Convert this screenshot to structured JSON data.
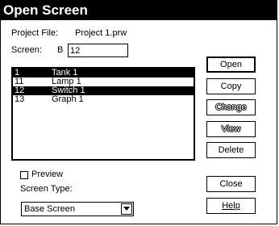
{
  "dialog": {
    "title": "Open Screen",
    "project_file_label": "Project File:",
    "project_file_value": "Project 1.prw",
    "screen_label": "Screen:",
    "screen_type_code": "B",
    "screen_number": "12"
  },
  "screen_list": [
    {
      "number": "1",
      "name": "Tank 1",
      "selected": true
    },
    {
      "number": "11",
      "name": "Lamp 1",
      "selected": false
    },
    {
      "number": "12",
      "name": "Switch 1",
      "selected": true
    },
    {
      "number": "13",
      "name": "Graph 1",
      "selected": false
    }
  ],
  "buttons": {
    "open": "Open",
    "copy": "Copy",
    "change": "Change",
    "view": "View",
    "delete": "Delete",
    "close": "Close",
    "help": "Help"
  },
  "preview_label": "Preview",
  "preview_checked": false,
  "screen_type_label": "Screen Type:",
  "screen_type_value": "Base Screen",
  "icons": [
    "checkbox-icon",
    "dropdown-arrow-icon"
  ]
}
